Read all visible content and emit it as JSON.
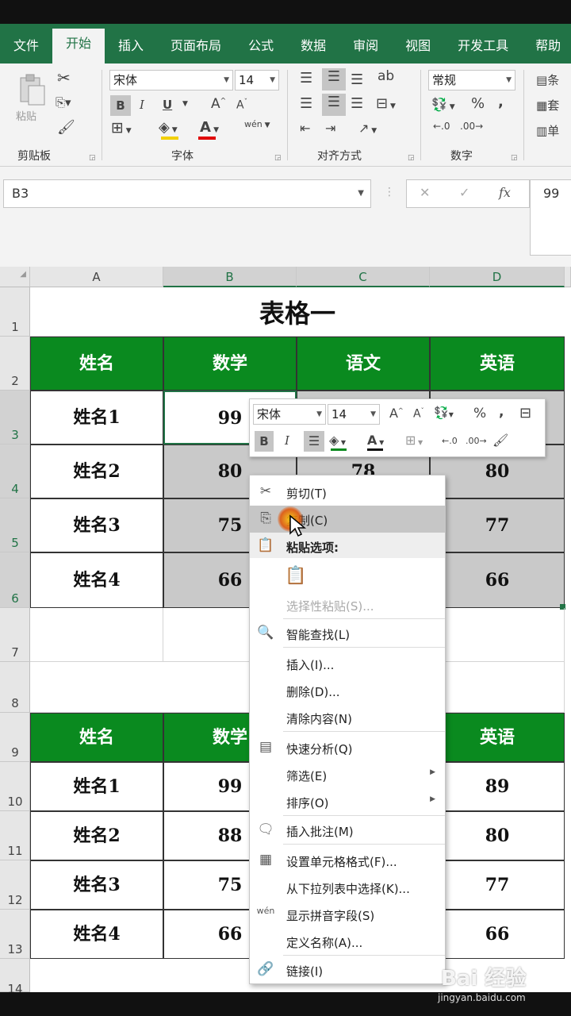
{
  "ribbon_tabs": [
    "文件",
    "开始",
    "插入",
    "页面布局",
    "公式",
    "数据",
    "审阅",
    "视图",
    "开发工具",
    "帮助"
  ],
  "ribbon": {
    "clipboard": {
      "label": "剪贴板",
      "paste_label": "粘贴"
    },
    "font": {
      "label": "字体",
      "font_name": "宋体",
      "font_size": "14",
      "bold": "B",
      "italic": "I",
      "underline": "U",
      "grow": "A",
      "shrink": "A",
      "font_color": "A",
      "phonetic": "wén"
    },
    "alignment": {
      "label": "对齐方式"
    },
    "number": {
      "label": "数字",
      "format": "常规",
      "percent": "%",
      "comma": ","
    },
    "styles": {
      "items": [
        "条",
        "套",
        "单"
      ]
    }
  },
  "formula_bar": {
    "name_box": "B3",
    "cancel": "✕",
    "enter": "✓",
    "fx": "fx",
    "value": "99"
  },
  "grid": {
    "columns": [
      "A",
      "B",
      "C",
      "D"
    ],
    "rows": [
      "1",
      "2",
      "3",
      "4",
      "5",
      "6",
      "7",
      "8",
      "9",
      "10",
      "11",
      "12",
      "13",
      "14"
    ],
    "title": "表格一",
    "table1": {
      "headers": [
        "姓名",
        "数学",
        "语文",
        "英语"
      ],
      "rows": [
        [
          "姓名1",
          "99",
          "",
          ""
        ],
        [
          "姓名2",
          "80",
          "78",
          "80"
        ],
        [
          "姓名3",
          "75",
          "",
          "77"
        ],
        [
          "姓名4",
          "66",
          "",
          "66"
        ]
      ]
    },
    "table2": {
      "headers": [
        "姓名",
        "数学",
        "",
        "英语"
      ],
      "rows": [
        [
          "姓名1",
          "99",
          "",
          "89"
        ],
        [
          "姓名2",
          "88",
          "",
          "80"
        ],
        [
          "姓名3",
          "75",
          "",
          "77"
        ],
        [
          "姓名4",
          "66",
          "",
          "66"
        ]
      ]
    }
  },
  "mini_toolbar": {
    "font_name": "宋体",
    "font_size": "14",
    "bold": "B",
    "italic": "I",
    "percent": "%",
    "comma": ","
  },
  "context_menu": {
    "cut": "剪切(T)",
    "copy": "复制(C)",
    "paste_options": "粘贴选项:",
    "paste_special": "选择性粘贴(S)...",
    "smart_lookup": "智能查找(L)",
    "insert": "插入(I)...",
    "delete": "删除(D)...",
    "clear": "清除内容(N)",
    "quick_analysis": "快速分析(Q)",
    "filter": "筛选(E)",
    "sort": "排序(O)",
    "insert_comment": "插入批注(M)",
    "format_cells": "设置单元格格式(F)...",
    "pick_list": "从下拉列表中选择(K)...",
    "phonetic": "显示拼音字段(S)",
    "define_name": "定义名称(A)...",
    "link": "链接(I)"
  },
  "watermark": {
    "brand": "Bai 经验",
    "url": "jingyan.baidu.com"
  },
  "colors": {
    "excel_green": "#217346",
    "header_green": "#0a8a1f",
    "selection": "#c9c9c9"
  }
}
